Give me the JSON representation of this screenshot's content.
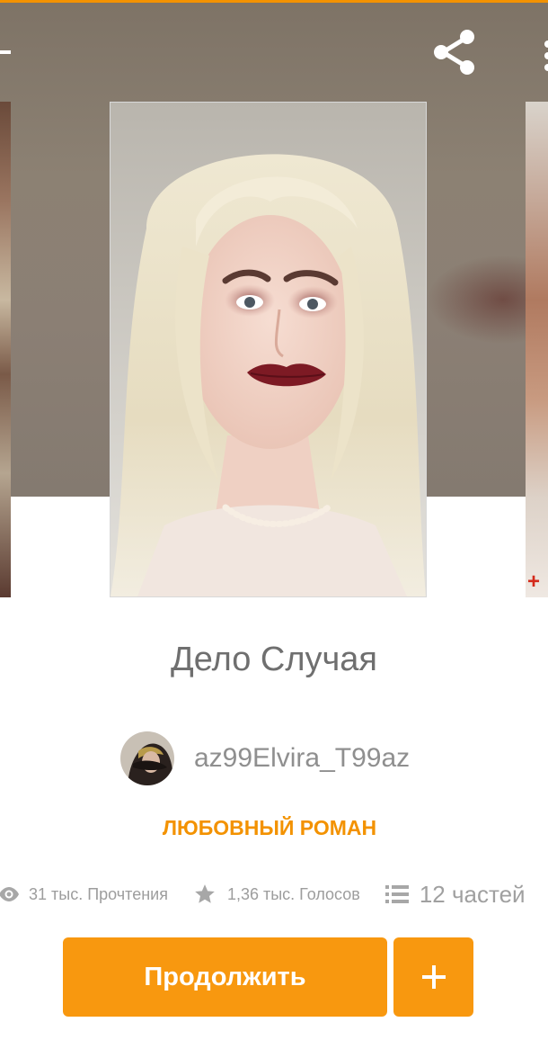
{
  "colors": {
    "accent": "#f39200",
    "button": "#f8980f",
    "title_text": "#6f6f6f",
    "muted_text": "#9d9d9d"
  },
  "app_bar": {
    "icons": [
      "arrow-left-icon",
      "share-icon",
      "more-vertical-icon"
    ]
  },
  "story": {
    "title": "Дело Случая",
    "author": "az99Elvira_T99az",
    "genre": "ЛЮБОВНЫЙ РОМАН",
    "cover_description": "portrait of a woman with platinum blonde hair, dark red lips and a pearl necklace"
  },
  "stats": {
    "reads": "31 тыс. Прочтения",
    "votes": "1,36 тыс. Голосов",
    "parts": "12 частей",
    "icons": [
      "eye-icon",
      "star-icon",
      "list-icon"
    ]
  },
  "actions": {
    "continue_label": "Продолжить",
    "add_icon": "plus-icon"
  },
  "side_covers": {
    "right_badge": "+"
  }
}
